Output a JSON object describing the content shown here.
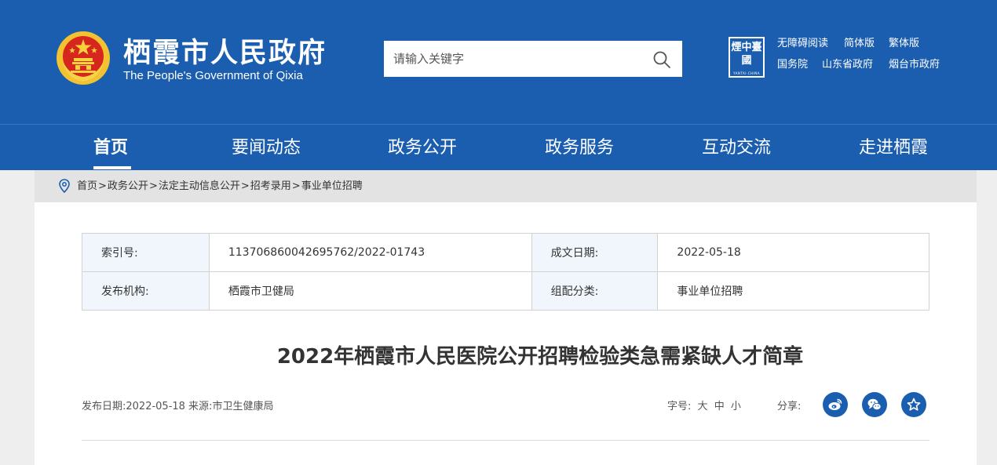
{
  "header": {
    "site_title": "栖霞市人民政府",
    "site_subtitle": "The People's Government of Qixia",
    "search": {
      "placeholder": "请输入关键字"
    },
    "brand_stamp": {
      "text": "煙中臺國",
      "sub": "YANTAI·CHINA"
    },
    "top_links": [
      "无障碍阅读",
      "简体版",
      "繁体版",
      "国务院",
      "山东省政府",
      "烟台市政府"
    ]
  },
  "nav": {
    "items": [
      "首页",
      "要闻动态",
      "政务公开",
      "政务服务",
      "互动交流",
      "走进栖霞"
    ],
    "active_index": 0
  },
  "breadcrumb": {
    "items": [
      "首页",
      "政务公开",
      "法定主动信息公开",
      "招考录用",
      "事业单位招聘"
    ],
    "separator": ">"
  },
  "meta": {
    "index_label": "索引号:",
    "index_value": "113706860042695762/2022-01743",
    "date_label": "成文日期:",
    "date_value": "2022-05-18",
    "publisher_label": "发布机构:",
    "publisher_value": "栖霞市卫健局",
    "category_label": "组配分类:",
    "category_value": "事业单位招聘"
  },
  "article": {
    "title": "2022年栖霞市人民医院公开招聘检验类急需紧缺人才简章",
    "info": "发布日期:2022-05-18 来源:市卫生健康局",
    "font_size_label": "字号:",
    "font_sizes": [
      "大",
      "中",
      "小"
    ],
    "share_label": "分享:",
    "share_icons": [
      "weibo-icon",
      "wechat-icon",
      "favorite-star-icon"
    ]
  },
  "colors": {
    "header_bg": "#1b5eb0",
    "page_bg": "#eeeeee",
    "table_label_bg": "#f1f6fc"
  }
}
